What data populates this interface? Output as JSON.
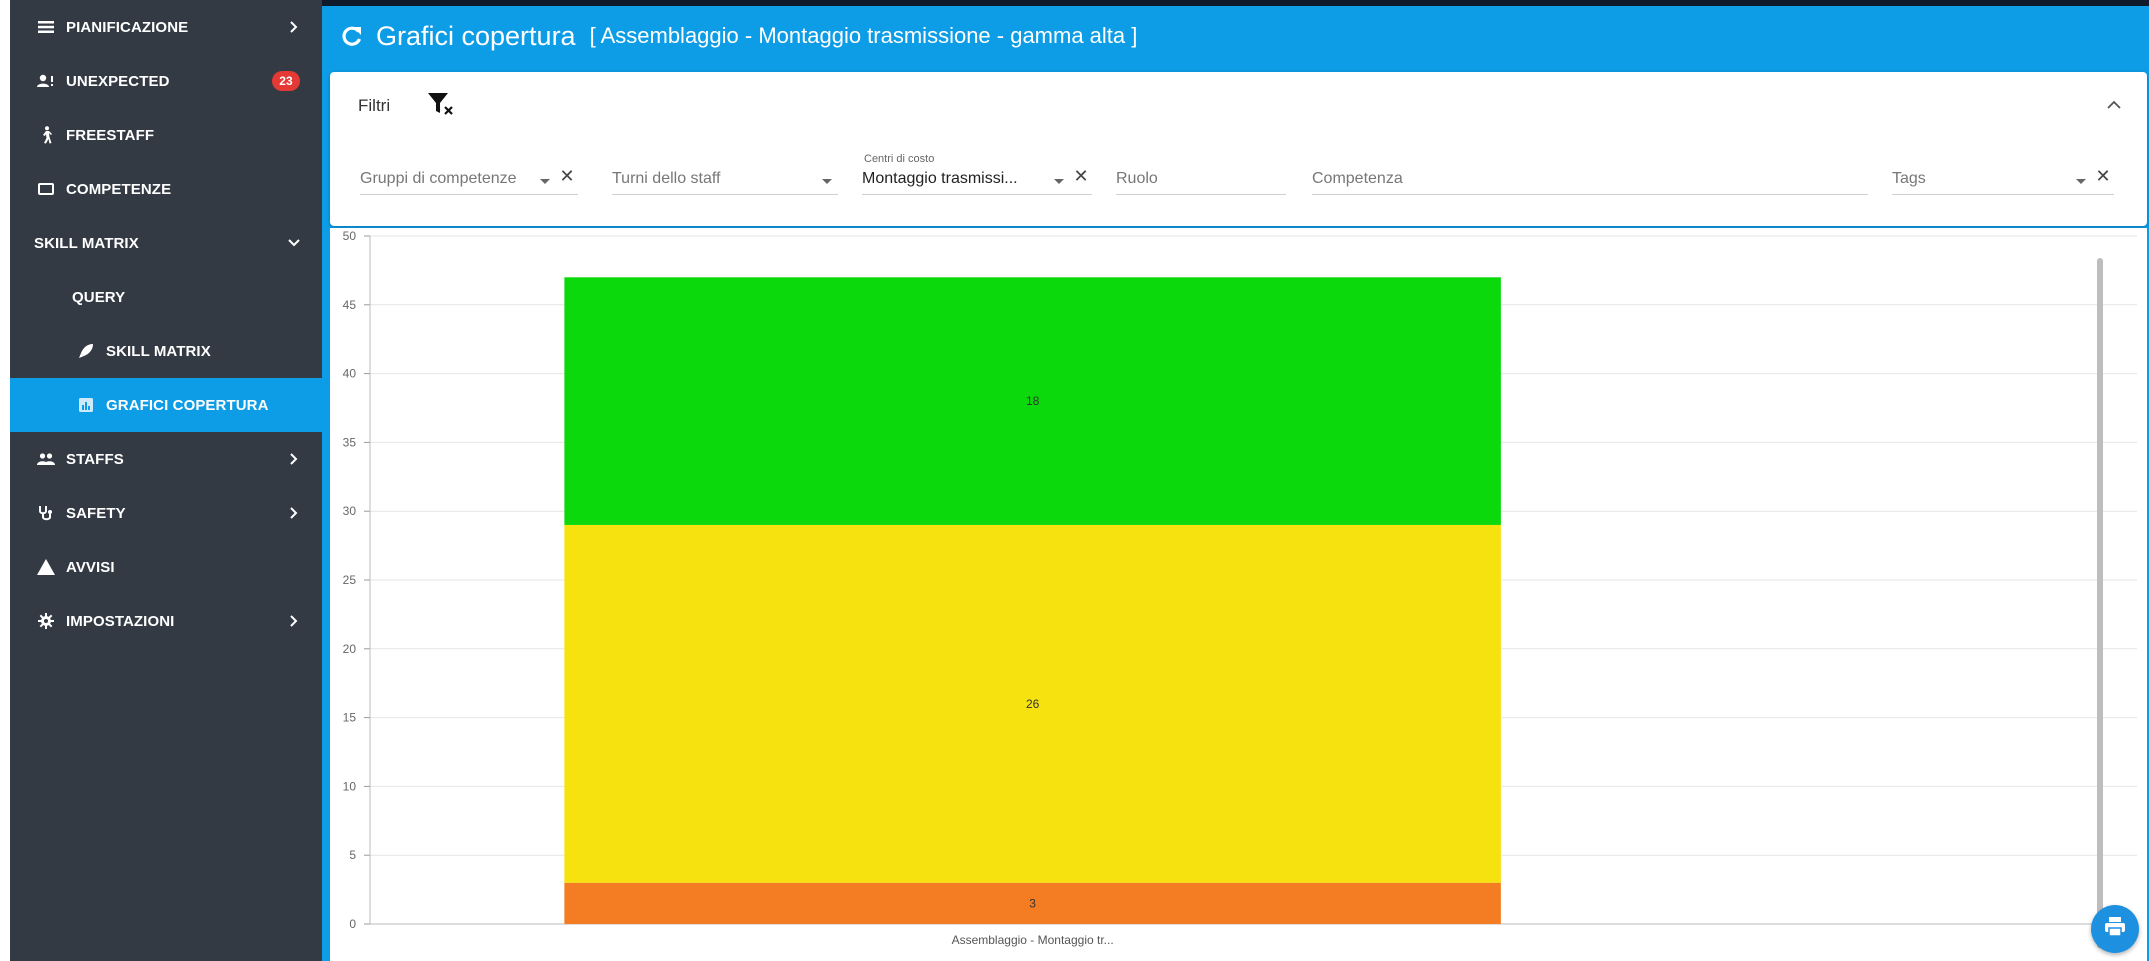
{
  "sidebar": {
    "items": [
      {
        "label": "PIANIFICAZIONE",
        "icon": "list-icon",
        "chevron": "right"
      },
      {
        "label": "UNEXPECTED",
        "icon": "person-alert-icon",
        "badge": "23"
      },
      {
        "label": "FREESTAFF",
        "icon": "walking-person-icon"
      },
      {
        "label": "COMPETENZE",
        "icon": "square-icon"
      },
      {
        "label": "SKILL MATRIX",
        "chevron": "down"
      },
      {
        "label": "QUERY"
      },
      {
        "label": "SKILL MATRIX",
        "icon": "rocket-icon"
      },
      {
        "label": "GRAFICI COPERTURA",
        "icon": "chart-icon",
        "active": true
      },
      {
        "label": "STAFFS",
        "icon": "people-icon",
        "chevron": "right"
      },
      {
        "label": "SAFETY",
        "icon": "stethoscope-icon",
        "chevron": "right"
      },
      {
        "label": "AVVISI",
        "icon": "warning-icon"
      },
      {
        "label": "IMPOSTAZIONI",
        "icon": "gear-icon",
        "chevron": "right"
      }
    ]
  },
  "header": {
    "title": "Grafici copertura",
    "subtitle": "[ Assemblaggio - Montaggio trasmissione - gamma alta ]"
  },
  "filters": {
    "label": "Filtri",
    "fields": {
      "gruppi": {
        "placeholder": "Gruppi di competenze"
      },
      "turni": {
        "placeholder": "Turni dello staff"
      },
      "centri": {
        "floating_label": "Centri di costo",
        "value": "Montaggio trasmissi..."
      },
      "ruolo": {
        "placeholder": "Ruolo"
      },
      "competenza": {
        "placeholder": "Competenza"
      },
      "tags": {
        "placeholder": "Tags"
      }
    },
    "clear_glyph": "✕"
  },
  "colors": {
    "primary": "#0d9ce6",
    "sidebar": "#343a44",
    "green": "#0cd90c",
    "yellow": "#f5e20f",
    "orange": "#f47d24"
  },
  "chart_data": {
    "type": "bar",
    "stacked": true,
    "categories": [
      "Assemblaggio - Montaggio tr..."
    ],
    "series": [
      {
        "values": [
          3
        ],
        "color": "#f47d24"
      },
      {
        "values": [
          26
        ],
        "color": "#f5e20f"
      },
      {
        "values": [
          18
        ],
        "color": "#0cd90c"
      }
    ],
    "ylim": [
      0,
      50
    ],
    "yticks": [
      0,
      5,
      10,
      15,
      20,
      25,
      30,
      35,
      40,
      45,
      50
    ],
    "grid": true
  }
}
